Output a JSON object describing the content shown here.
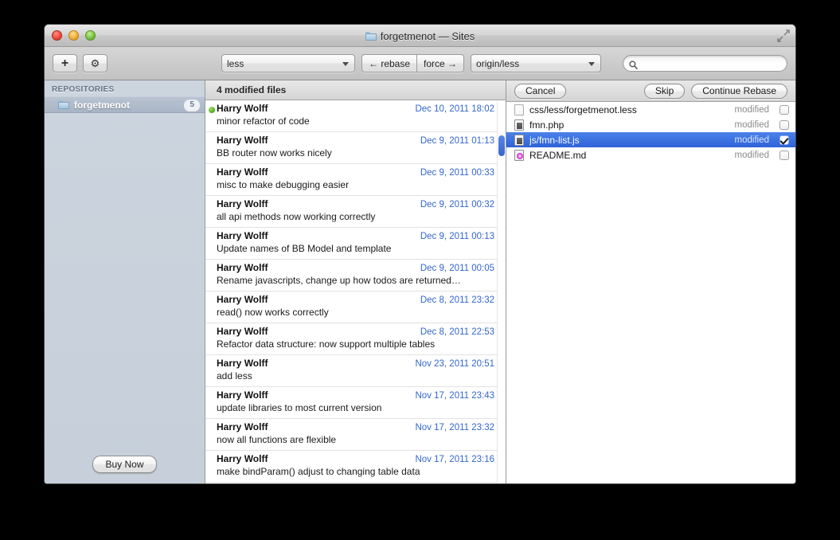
{
  "window": {
    "title": "forgetmenot — Sites",
    "title_icon": "folder-icon",
    "fullscreen_icon": "fullscreen-arrows-icon"
  },
  "toolbar": {
    "add_button": {
      "icon": "plus-icon",
      "label": "+"
    },
    "settings_button": {
      "icon": "gear-icon",
      "label": "⚙"
    },
    "branch_popup": {
      "value": "less",
      "caret": "chevron-down-icon"
    },
    "rebase_segment": {
      "label": "← rebase"
    },
    "force_segment": {
      "label": "force →"
    },
    "remote_popup": {
      "value": "origin/less",
      "caret": "chevron-down-icon"
    },
    "search": {
      "icon": "search-icon",
      "value": "",
      "placeholder": ""
    }
  },
  "sidebar": {
    "header": "REPOSITORIES",
    "items": [
      {
        "label": "forgetmenot",
        "badge": "5",
        "icon": "folder-icon",
        "selected": true
      }
    ],
    "buy_button": "Buy Now"
  },
  "commits": {
    "header": "4 modified files",
    "list": [
      {
        "author": "Harry Wolff",
        "date": "Dec 10, 2011 18:02",
        "message": "minor refactor of code",
        "dot": true
      },
      {
        "author": "Harry Wolff",
        "date": "Dec 9, 2011 01:13",
        "message": "BB router now works nicely",
        "dot": false
      },
      {
        "author": "Harry Wolff",
        "date": "Dec 9, 2011 00:33",
        "message": "misc to make debugging easier",
        "dot": false
      },
      {
        "author": "Harry Wolff",
        "date": "Dec 9, 2011 00:32",
        "message": "all api methods now working correctly",
        "dot": false
      },
      {
        "author": "Harry Wolff",
        "date": "Dec 9, 2011 00:13",
        "message": "Update names of BB Model and template",
        "dot": false
      },
      {
        "author": "Harry Wolff",
        "date": "Dec 9, 2011 00:05",
        "message": "Rename javascripts, change up how todos are returned…",
        "dot": false
      },
      {
        "author": "Harry Wolff",
        "date": "Dec 8, 2011 23:32",
        "message": "read() now works correctly",
        "dot": false
      },
      {
        "author": "Harry Wolff",
        "date": "Dec 8, 2011 22:53",
        "message": "Refactor data structure: now support multiple tables",
        "dot": false
      },
      {
        "author": "Harry Wolff",
        "date": "Nov 23, 2011 20:51",
        "message": "add less",
        "dot": false
      },
      {
        "author": "Harry Wolff",
        "date": "Nov 17, 2011 23:43",
        "message": "update libraries to most current version",
        "dot": false
      },
      {
        "author": "Harry Wolff",
        "date": "Nov 17, 2011 23:32",
        "message": "now all functions are flexible",
        "dot": false
      },
      {
        "author": "Harry Wolff",
        "date": "Nov 17, 2011 23:16",
        "message": "make bindParam() adjust to changing table data",
        "dot": false
      }
    ]
  },
  "files_pane": {
    "cancel_button": "Cancel",
    "skip_button": "Skip",
    "continue_button": "Continue Rebase",
    "rows": [
      {
        "name": "css/less/forgetmenot.less",
        "status": "modified",
        "icon": "document-icon",
        "icon_kind": "fi-doc",
        "checked": false,
        "selected": false
      },
      {
        "name": "fmn.php",
        "status": "modified",
        "icon": "code-document-icon",
        "icon_kind": "fi-code",
        "checked": false,
        "selected": false
      },
      {
        "name": "js/fmn-list.js",
        "status": "modified",
        "icon": "code-document-icon",
        "icon_kind": "fi-code",
        "checked": true,
        "selected": true
      },
      {
        "name": "README.md",
        "status": "modified",
        "icon": "markdown-document-icon",
        "icon_kind": "fi-md",
        "checked": false,
        "selected": false
      }
    ]
  },
  "colors": {
    "accent_blue": "#3366cc",
    "selection_blue": "#2f62d8",
    "commit_date": "#3366cc",
    "status_gray": "#8b8b8b",
    "sidebar_bg": "#c9d2dd",
    "green_dot": "#55b026"
  }
}
